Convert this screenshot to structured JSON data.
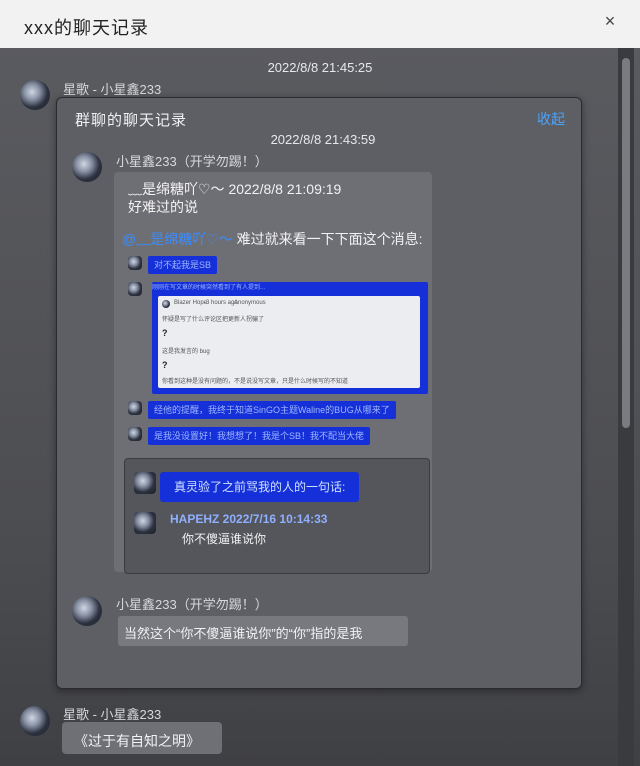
{
  "window": {
    "title": "xxx的聊天记录",
    "close_icon": "×"
  },
  "outer": {
    "timestamp_top": "2022/8/8 21:45:25",
    "sender_top": "星歌 - 小星鑫233",
    "sender_bottom": "星歌 - 小星鑫233",
    "last_message": "《过于有自知之明》"
  },
  "card": {
    "title": "群聊的聊天记录",
    "collapse_label": "收起",
    "timestamp": "2022/8/8 21:43:59",
    "sender1": "小星鑫233（开学勿踢！）",
    "quoted_header": "﹏是绵糖吖♡～ 2022/8/8 21:09:19",
    "quoted_text": "好难过的说",
    "mention": "@﹏是绵糖吖♡～",
    "mention_text": " 难过就来看一下下面这个消息:",
    "pill1": "对不起我是SB",
    "pill_shot_header": "刚刚在写文章的时候突然看到了有人提到...",
    "shot_user": "Blazer Hope",
    "shot_time": "3 hours ago",
    "shot_tag": "Anonymous",
    "shot_line1": "怀疑是写了什么评论区把更新人拐骗了",
    "shot_q1": "?",
    "shot_line2": "这是我发言的 bug",
    "shot_q2": "?",
    "shot_line3": "你看到这种是没有问题的，不是说没写文章，只是什么时候写的不知道",
    "pill2": "经他的提醒，我终于知道SinGO主题Waline的BUG从哪来了",
    "pill3": "是我没设置好！我想想了！我是个SB！我不配当大佬",
    "quote_pill": "真灵验了之前骂我的人的一句话:",
    "quote_user": "HAPEHZ 2022/7/16 10:14:33",
    "quote_text": "你不傻逼谁说你",
    "sender2": "小星鑫233（开学勿踢！）",
    "reply": "当然这个“你不傻逼谁说你”的“你”指的是我"
  },
  "colors": {
    "link": "#4aa3ff",
    "pill": "#1530d8"
  }
}
